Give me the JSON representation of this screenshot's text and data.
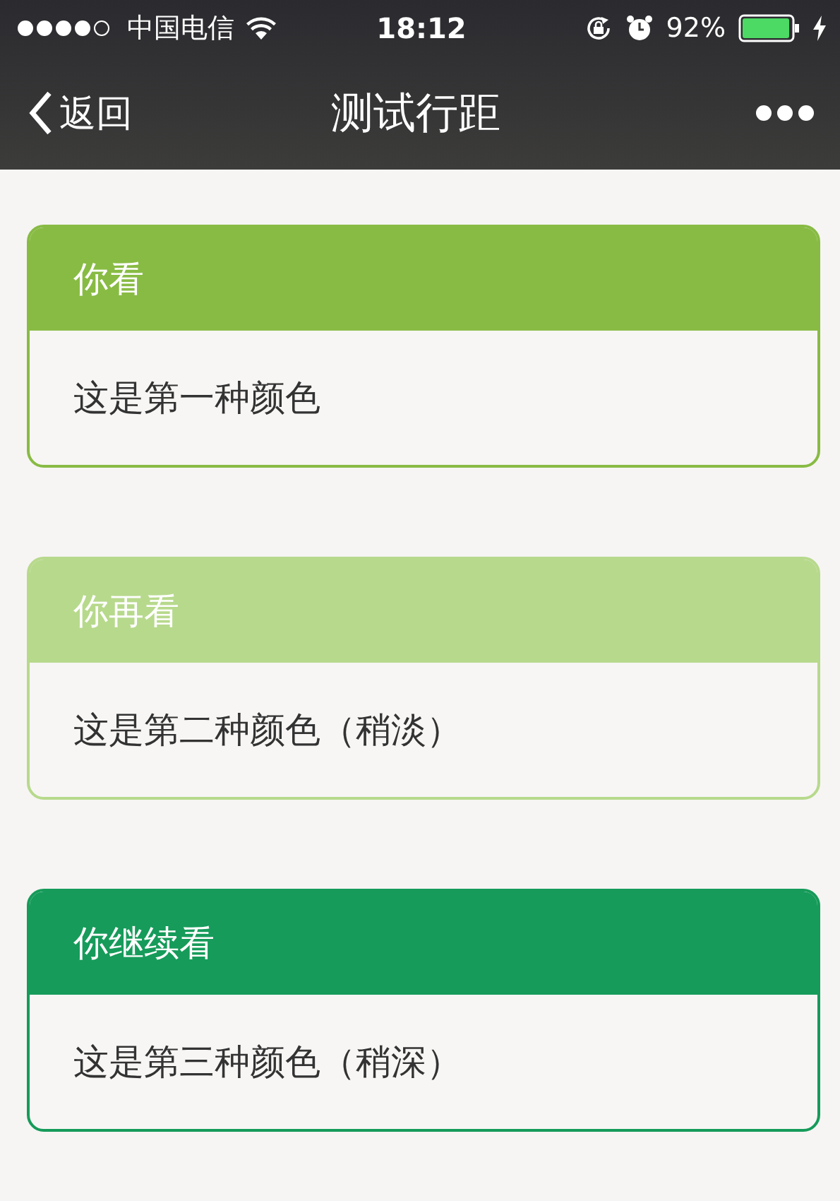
{
  "status_bar": {
    "carrier": "中国电信",
    "time": "18:12",
    "battery": "92%"
  },
  "nav_bar": {
    "back": "返回",
    "title": "测试行距"
  },
  "cards": [
    {
      "title": "你看",
      "body": "这是第一种颜色",
      "color": "#88bb44"
    },
    {
      "title": "你再看",
      "body": "这是第二种颜色（稍淡）",
      "color": "#b7d98c"
    },
    {
      "title": "你继续看",
      "body": "这是第三种颜色（稍深）",
      "color": "#169b5a"
    }
  ]
}
